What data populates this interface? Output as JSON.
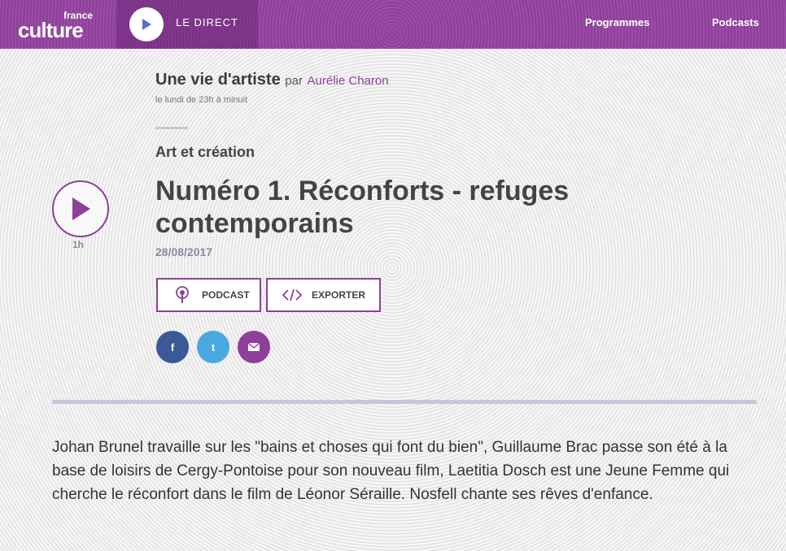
{
  "header": {
    "logo": {
      "line1": "france",
      "line2": "culture"
    },
    "live_label": "LE DIRECT",
    "nav": [
      "Programmes",
      "Podcasts"
    ]
  },
  "show": {
    "title": "Une vie d'artiste",
    "by": "par",
    "author": "Aurélie Charon",
    "schedule": "le lundi de 23h à minuit"
  },
  "episode": {
    "category": "Art et création",
    "title": "Numéro 1. Réconforts - refuges contemporains",
    "date": "28/08/2017",
    "duration": "1h"
  },
  "actions": {
    "podcast_label": "PODCAST",
    "export_label": "EXPORTER"
  },
  "share": {
    "facebook_glyph": "f",
    "twitter_glyph": "t"
  },
  "description": "Johan Brunel travaille sur les \"bains et choses qui font du bien\", Guillaume Brac passe son été à la base de loisirs de Cergy-Pontoise pour son nouveau film, Laetitia Dosch est une Jeune Femme qui cherche le réconfort dans le film de Léonor Séraille. Nosfell chante ses rêves d'enfance.",
  "colors": {
    "brand": "#8e3f9a",
    "facebook": "#3b5998",
    "twitter": "#4aa8e0"
  },
  "icons": [
    "play-icon",
    "podcast-icon",
    "code-icon",
    "facebook-icon",
    "twitter-icon",
    "mail-icon"
  ]
}
